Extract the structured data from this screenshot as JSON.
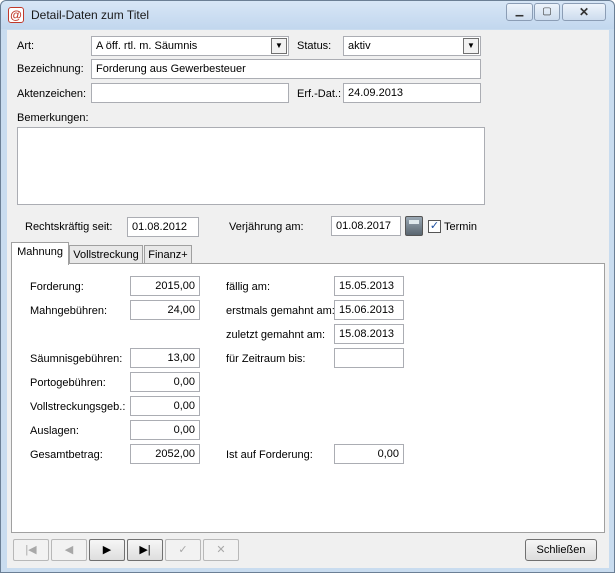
{
  "window": {
    "title": "Detail-Daten zum Titel",
    "app_icon": "@"
  },
  "labels": {
    "art": "Art:",
    "status": "Status:",
    "bezeichnung": "Bezeichnung:",
    "aktenzeichen": "Aktenzeichen:",
    "erf_dat": "Erf.-Dat.:",
    "bemerkungen": "Bemerkungen:",
    "rechtskraeftig": "Rechtskräftig seit:",
    "verjaehrung": "Verjährung am:",
    "termin": "Termin"
  },
  "values": {
    "art": "A öff. rtl. m. Säumnis",
    "status": "aktiv",
    "bezeichnung": "Forderung aus Gewerbesteuer",
    "aktenzeichen": "",
    "erf_dat": "24.09.2013",
    "bemerkungen": "",
    "rechtskraeftig": "01.08.2012",
    "verjaehrung": "01.08.2017",
    "termin_checked": true
  },
  "tabs": [
    "Mahnung",
    "Vollstreckung",
    "Finanz+"
  ],
  "mahnung": {
    "left": [
      {
        "label": "Forderung:",
        "value": "2015,00"
      },
      {
        "label": "Mahngebühren:",
        "value": "24,00"
      },
      {
        "label": "Säumnisgebühren:",
        "value": "13,00"
      },
      {
        "label": "Portogebühren:",
        "value": "0,00"
      },
      {
        "label": "Vollstreckungsgeb.:",
        "value": "0,00"
      },
      {
        "label": "Auslagen:",
        "value": "0,00"
      },
      {
        "label": "Gesamtbetrag:",
        "value": "2052,00"
      }
    ],
    "right": [
      {
        "label": "fällig am:",
        "value": "15.05.2013"
      },
      {
        "label": "erstmals gemahnt am:",
        "value": "15.06.2013"
      },
      {
        "label": "zuletzt gemahnt am:",
        "value": "15.08.2013"
      },
      {
        "label": "für Zeitraum bis:",
        "value": ""
      },
      {
        "label": "Ist auf Forderung:",
        "value": "0,00"
      }
    ]
  },
  "nav": {
    "first": "|◀",
    "prev": "◀",
    "next": "▶",
    "last": "▶|",
    "edit": "✓",
    "cancel": "✕"
  },
  "buttons": {
    "close": "Schließen"
  },
  "icons": {
    "app": "app-logo-icon",
    "minimize": "minimize-icon",
    "maximize": "maximize-icon",
    "close": "close-icon",
    "calculator": "calculator-icon",
    "dropdown": "chevron-down-icon",
    "check": "check-icon"
  }
}
